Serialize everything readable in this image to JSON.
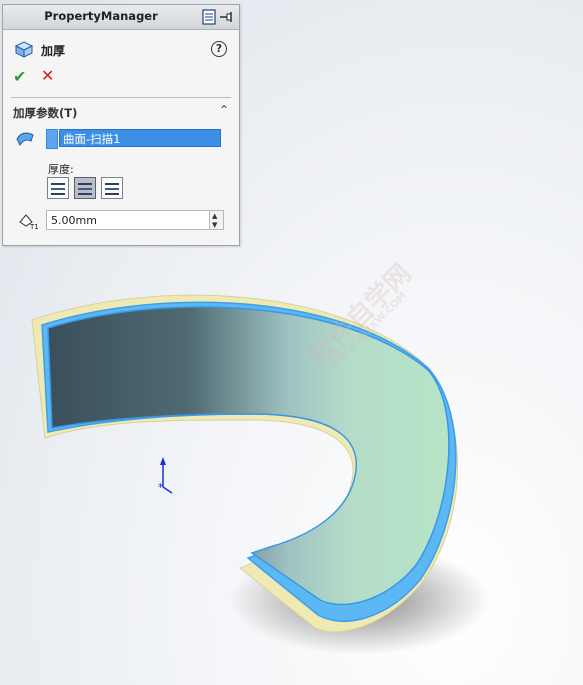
{
  "panel": {
    "title": "PropertyManager",
    "feature_name": "加厚",
    "help_glyph": "?",
    "ok_glyph": "✔",
    "cancel_glyph": "✕",
    "group_title": "加厚参数(T)",
    "group_caret": "⌃",
    "selection": {
      "items": [
        "曲面-扫描1"
      ],
      "color": "#5ea4ef"
    },
    "thickness_label": "厚度:",
    "thickness_options": [
      "side-1",
      "both-sides",
      "side-2"
    ],
    "thickness_selected": 1,
    "thickness_value": "5.00mm",
    "spin_up": "▲",
    "spin_down": "▼"
  },
  "viewport": {
    "watermark_text": "软件自学网",
    "watermark_url": "WWW.RJZXW.COM",
    "colors": {
      "face_top": "#b2e5c4",
      "edge": "#4da9f2",
      "offset": "#efeab4",
      "inner_dark": "#3d5460"
    }
  }
}
